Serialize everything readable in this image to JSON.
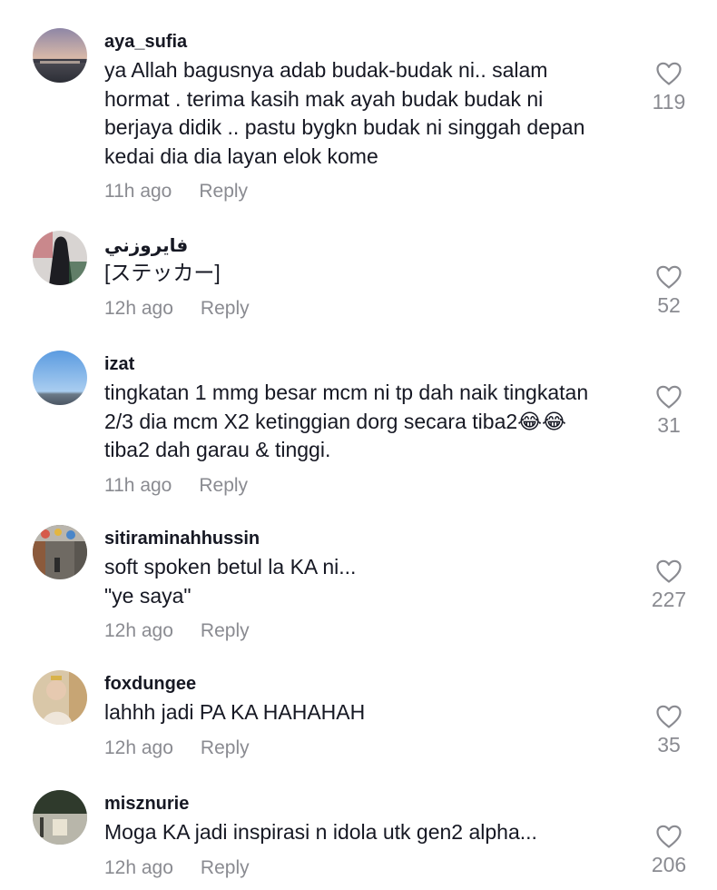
{
  "comments": [
    {
      "username": "aya_sufia",
      "lines": [
        "ya Allah bagusnya adab budak-budak ni.. salam",
        "hormat . terima kasih mak ayah budak budak ni",
        "berjaya didik .. pastu bygkn budak ni singgah depan",
        "kedai dia dia layan elok kome"
      ],
      "time": "11h ago",
      "reply": "Reply",
      "likes": "119",
      "avatar_icon": "sunset-landscape-icon"
    },
    {
      "username": "فايروزني",
      "lines": [
        "[ステッカー]"
      ],
      "time": "12h ago",
      "reply": "Reply",
      "likes": "52",
      "avatar_icon": "veiled-figure-icon"
    },
    {
      "username": "izat",
      "lines": [
        "tingkatan 1 mmg besar mcm ni tp dah naik tingkatan",
        "2/3 dia mcm X2 ketinggian dorg secara tiba2😂😂",
        "tiba2 dah garau & tinggi."
      ],
      "time": "11h ago",
      "reply": "Reply",
      "likes": "31",
      "avatar_icon": "blue-sky-icon"
    },
    {
      "username": "sitiraminahhussin",
      "lines": [
        "soft spoken betul la KA ni...",
        "\"ye saya\""
      ],
      "time": "12h ago",
      "reply": "Reply",
      "likes": "227",
      "avatar_icon": "street-scene-icon"
    },
    {
      "username": "foxdungee",
      "lines": [
        "lahhh jadi PA KA HAHAHAH"
      ],
      "time": "12h ago",
      "reply": "Reply",
      "likes": "35",
      "avatar_icon": "person-photo-icon"
    },
    {
      "username": "misznurie",
      "lines": [
        "Moga KA jadi inspirasi n idola utk gen2 alpha..."
      ],
      "time": "12h ago",
      "reply": "Reply",
      "likes": "206",
      "avatar_icon": "park-scene-icon"
    }
  ]
}
